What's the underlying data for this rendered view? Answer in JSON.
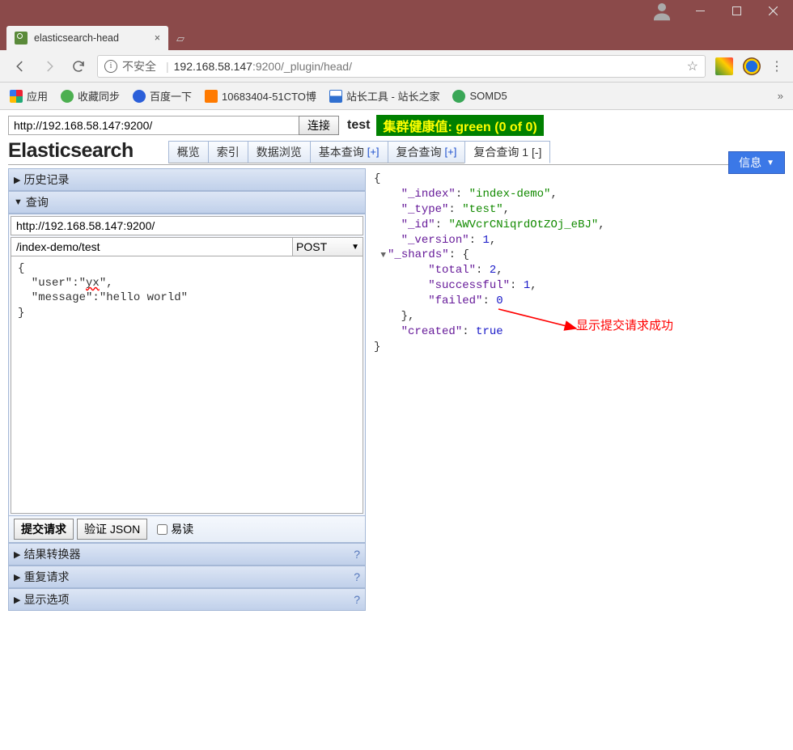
{
  "window": {
    "tab_title": "elasticsearch-head",
    "url_insecure_label": "不安全",
    "url_host": "192.168.58.147",
    "url_port": ":9200",
    "url_path": "/_plugin/head/"
  },
  "bookmarks": {
    "apps_label": "应用",
    "items": [
      {
        "label": "收藏同步"
      },
      {
        "label": "百度一下"
      },
      {
        "label": "10683404-51CTO博"
      },
      {
        "label": "站长工具 - 站长之家"
      },
      {
        "label": "SOMD5"
      }
    ]
  },
  "es_head": {
    "connect_url": "http://192.168.58.147:9200/",
    "connect_btn": "连接",
    "cluster_name": "test",
    "health_text": "集群健康值: green (0 of 0)",
    "logo": "Elasticsearch",
    "tabs": {
      "overview": "概览",
      "indices": "索引",
      "browser": "数据浏览",
      "basic_query": "基本查询",
      "compound_query": "复合查询",
      "compound_query_active": "复合查询 1 [-]"
    },
    "plus": "[+]",
    "info_btn": "信息"
  },
  "left_panels": {
    "history": "历史记录",
    "query": "查询",
    "result_transformer": "结果转换器",
    "repeat_request": "重复请求",
    "display_options": "显示选项"
  },
  "query_form": {
    "server": "http://192.168.58.147:9200/",
    "path": "/index-demo/test",
    "method": "POST",
    "body_pre": "{\n  \"user\":\"",
    "body_user": "yx",
    "body_mid": "\",\n  \"message\":\"hello world\"\n}"
  },
  "actions": {
    "submit": "提交请求",
    "validate": "验证 JSON",
    "pretty": "易读"
  },
  "response": {
    "k_index": "\"_index\"",
    "v_index": "\"index-demo\"",
    "k_type": "\"_type\"",
    "v_type": "\"test\"",
    "k_id": "\"_id\"",
    "v_id": "\"AWVcrCNiqrdOtZOj_eBJ\"",
    "k_version": "\"_version\"",
    "v_version": "1",
    "k_shards": "\"_shards\"",
    "k_total": "\"total\"",
    "v_total": "2",
    "k_successful": "\"successful\"",
    "v_successful": "1",
    "k_failed": "\"failed\"",
    "v_failed": "0",
    "k_created": "\"created\"",
    "v_created": "true"
  },
  "annotation": "显示提交请求成功"
}
